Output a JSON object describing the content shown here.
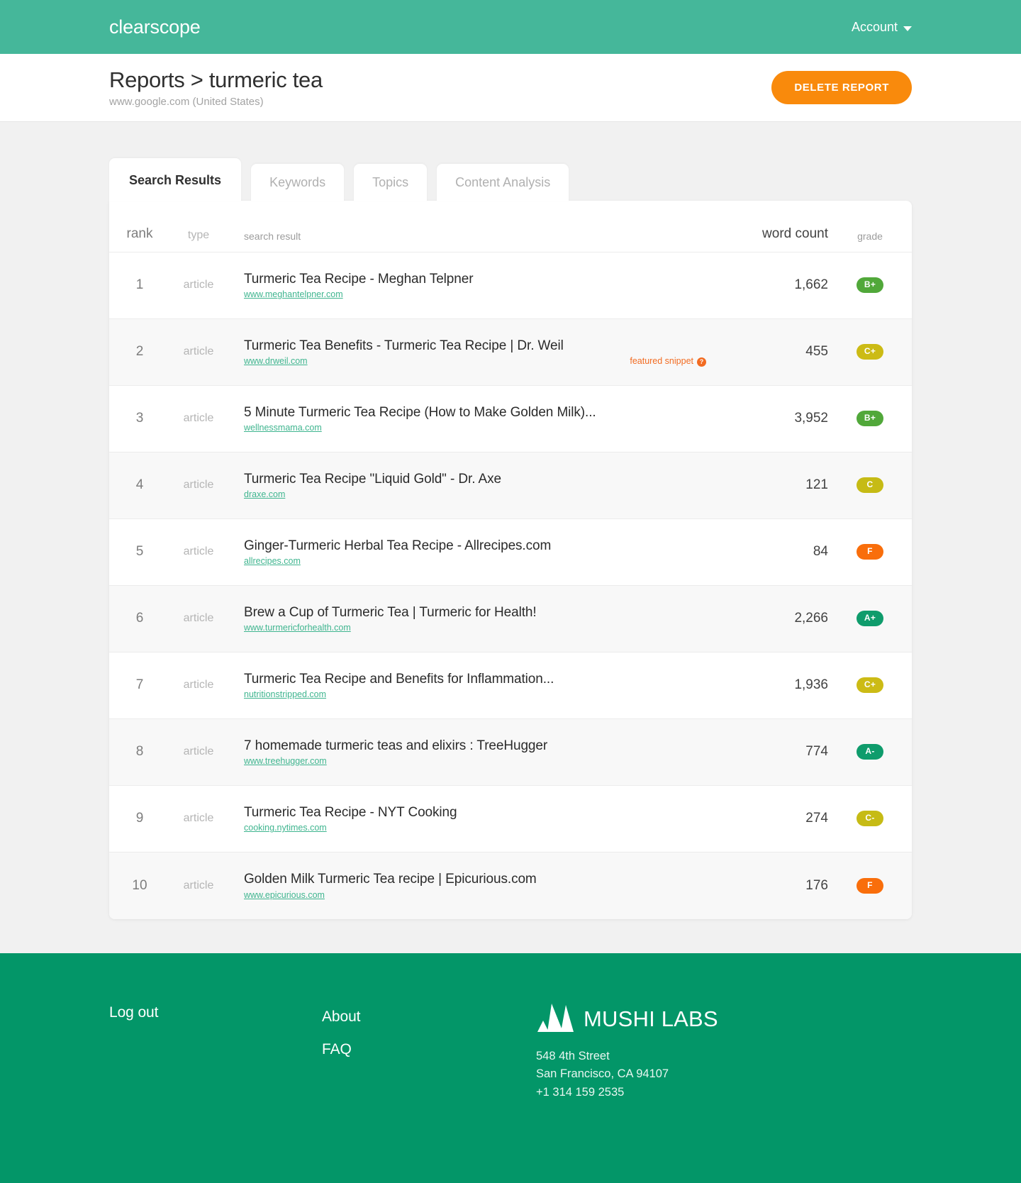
{
  "colors": {
    "nav_teal": "#45b79a",
    "footer_green": "#039668",
    "accent_orange": "#f98a0c",
    "link_green": "#3fb58f",
    "snippet_orange": "#f26b21"
  },
  "topnav": {
    "brand": "clearscope",
    "account_label": "Account",
    "caret_icon": "chevron-down-icon"
  },
  "report_header": {
    "title": "Reports > turmeric tea",
    "subtitle": "www.google.com (United States)",
    "delete_label": "DELETE REPORT"
  },
  "tabs": [
    {
      "label": "Search Results",
      "active": true
    },
    {
      "label": "Keywords",
      "active": false
    },
    {
      "label": "Topics",
      "active": false
    },
    {
      "label": "Content Analysis",
      "active": false
    }
  ],
  "table": {
    "headers": {
      "rank": "rank",
      "type": "type",
      "result": "search result",
      "word_count": "word count",
      "grade": "grade"
    },
    "rows": [
      {
        "rank": "1",
        "type": "article",
        "title": "Turmeric Tea Recipe - Meghan Telpner",
        "url": "www.meghantelpner.com",
        "word_count": "1,662",
        "grade": "B+",
        "grade_color": "#51a83a",
        "featured_snippet": ""
      },
      {
        "rank": "2",
        "type": "article",
        "title": "Turmeric Tea Benefits - Turmeric Tea Recipe | Dr. Weil",
        "url": "www.drweil.com",
        "word_count": "455",
        "grade": "C+",
        "grade_color": "#ccbb15",
        "featured_snippet": "featured snippet"
      },
      {
        "rank": "3",
        "type": "article",
        "title": "5 Minute Turmeric Tea Recipe (How to Make Golden Milk)...",
        "url": "wellnessmama.com",
        "word_count": "3,952",
        "grade": "B+",
        "grade_color": "#51a83a",
        "featured_snippet": ""
      },
      {
        "rank": "4",
        "type": "article",
        "title": "Turmeric Tea Recipe \"Liquid Gold\" - Dr. Axe",
        "url": "draxe.com",
        "word_count": "121",
        "grade": "C",
        "grade_color": "#c6bb15",
        "featured_snippet": ""
      },
      {
        "rank": "5",
        "type": "article",
        "title": "Ginger-Turmeric Herbal Tea Recipe - Allrecipes.com",
        "url": "allrecipes.com",
        "word_count": "84",
        "grade": "F",
        "grade_color": "#f96e0b",
        "featured_snippet": ""
      },
      {
        "rank": "6",
        "type": "article",
        "title": "Brew a Cup of Turmeric Tea | Turmeric for Health!",
        "url": "www.turmericforhealth.com",
        "word_count": "2,266",
        "grade": "A+",
        "grade_color": "#0f9c6c",
        "featured_snippet": ""
      },
      {
        "rank": "7",
        "type": "article",
        "title": "Turmeric Tea Recipe and Benefits for Inflammation...",
        "url": "nutritionstripped.com",
        "word_count": "1,936",
        "grade": "C+",
        "grade_color": "#ccbb15",
        "featured_snippet": ""
      },
      {
        "rank": "8",
        "type": "article",
        "title": "7 homemade turmeric teas and elixirs : TreeHugger",
        "url": "www.treehugger.com",
        "word_count": "774",
        "grade": "A-",
        "grade_color": "#0f9c6c",
        "featured_snippet": ""
      },
      {
        "rank": "9",
        "type": "article",
        "title": "Turmeric Tea Recipe - NYT Cooking",
        "url": "cooking.nytimes.com",
        "word_count": "274",
        "grade": "C-",
        "grade_color": "#c6bb15",
        "featured_snippet": ""
      },
      {
        "rank": "10",
        "type": "article",
        "title": "Golden Milk Turmeric Tea recipe | Epicurious.com",
        "url": "www.epicurious.com",
        "word_count": "176",
        "grade": "F",
        "grade_color": "#f96e0b",
        "featured_snippet": ""
      }
    ]
  },
  "footer": {
    "logout_label": "Log out",
    "about_label": "About",
    "faq_label": "FAQ",
    "company_name": "MUSHI LABS",
    "address_line1": "548 4th Street",
    "address_line2": "San Francisco, CA 94107",
    "phone": "+1 314 159 2535"
  }
}
